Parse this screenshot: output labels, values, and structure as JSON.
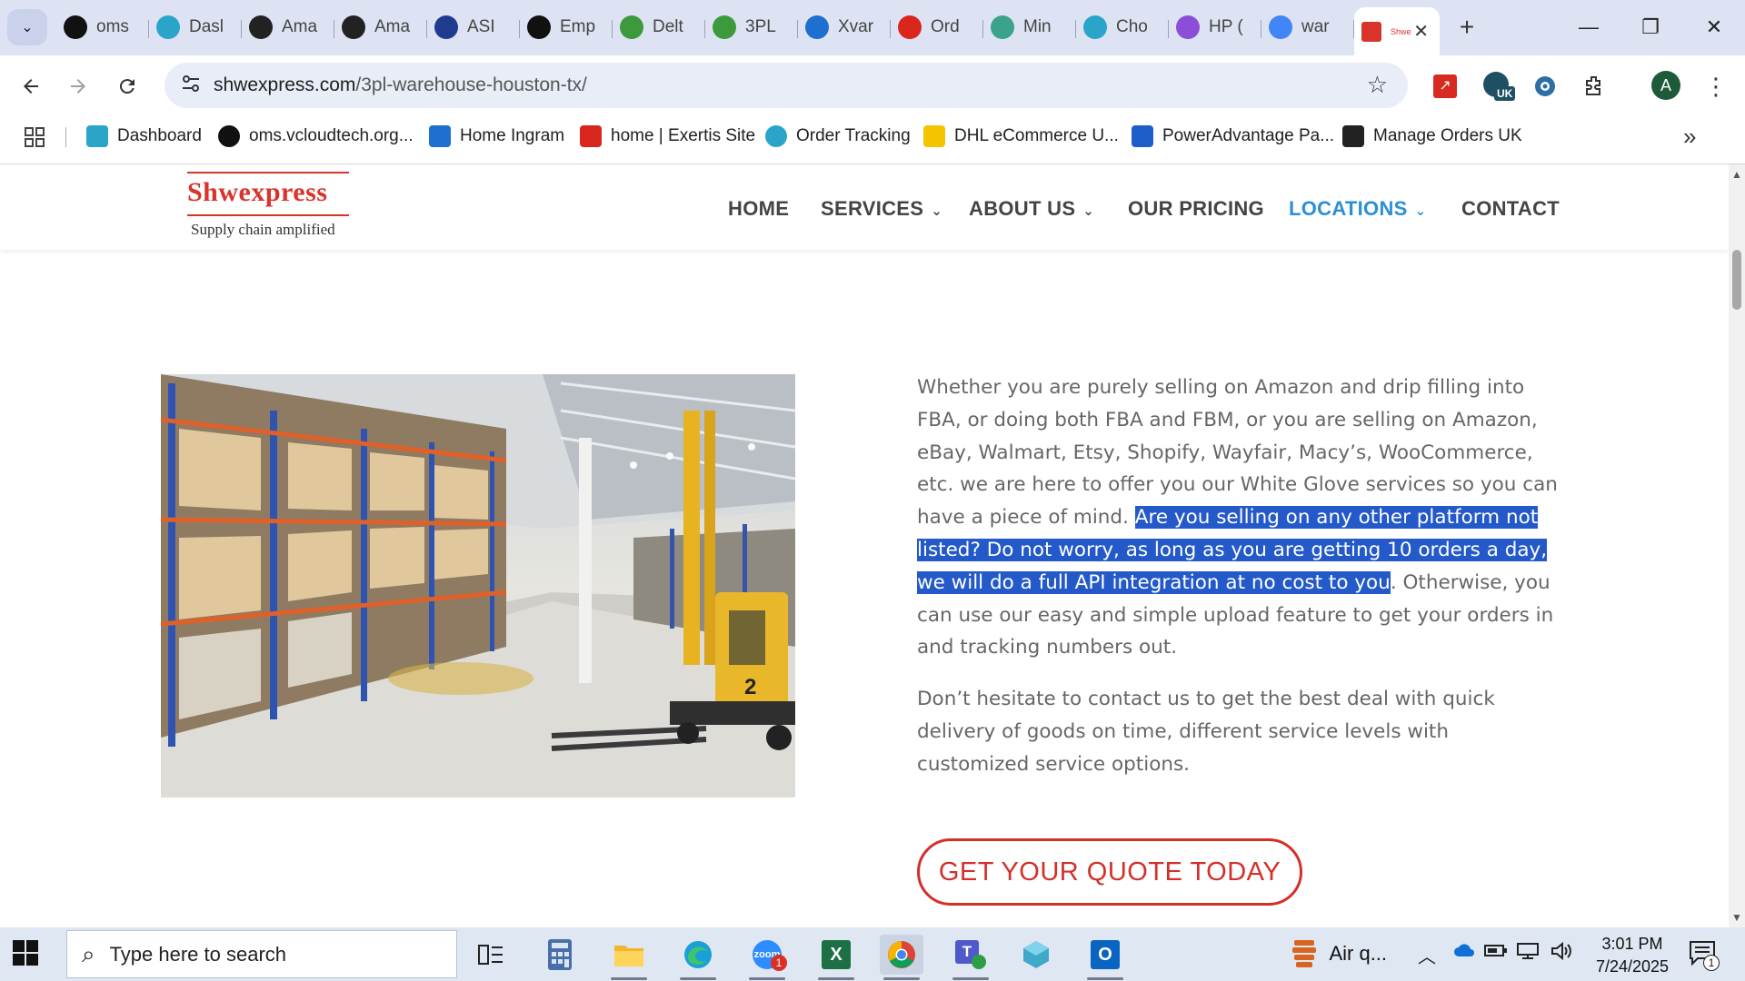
{
  "browser": {
    "tabs": [
      {
        "title": "oms",
        "icon": "vcloud-icon",
        "color": "#111111"
      },
      {
        "title": "Dasl",
        "icon": "dashboard-icon",
        "color": "#2aa5c9"
      },
      {
        "title": "Ama",
        "icon": "amazon-icon",
        "color": "#222222"
      },
      {
        "title": "Ama",
        "icon": "amazon-icon",
        "color": "#222222"
      },
      {
        "title": "ASI",
        "icon": "asi-icon",
        "color": "#1f3b8f"
      },
      {
        "title": "Emp",
        "icon": "openai-icon",
        "color": "#111111"
      },
      {
        "title": "Delt",
        "icon": "spreadsheet-icon",
        "color": "#3c9a3c"
      },
      {
        "title": "3PL",
        "icon": "spreadsheet-icon",
        "color": "#3c9a3c"
      },
      {
        "title": "Xvar",
        "icon": "xvantage-icon",
        "color": "#1e6fcf"
      },
      {
        "title": "Ord",
        "icon": "exertis-icon",
        "color": "#d9261c"
      },
      {
        "title": "Min",
        "icon": "leaf-icon",
        "color": "#3aa38a"
      },
      {
        "title": "Cho",
        "icon": "order-tracking-icon",
        "color": "#2aa5c9"
      },
      {
        "title": "HP (",
        "icon": "hp-icon",
        "color": "#8a4fd6"
      },
      {
        "title": "war",
        "icon": "google-icon",
        "color": "#4285f4"
      },
      {
        "title": "Shwe",
        "icon": "shwexpress-favicon-icon",
        "color": "#d9342b",
        "active": true
      }
    ],
    "close_tab_symbol": "✕",
    "new_tab_symbol": "+",
    "window_controls": {
      "minimize": "—",
      "restore": "❐",
      "close": "✕"
    },
    "url_host": "shwexpress.com",
    "url_path": "/3pl-warehouse-houston-tx/",
    "profile_initial": "A",
    "uk_badge": "UK",
    "bookmarks": [
      {
        "label": "Dashboard",
        "icon": "dashboard-icon",
        "color": "#2aa5c9"
      },
      {
        "label": "oms.vcloudtech.org...",
        "icon": "vcloud-icon",
        "color": "#111111"
      },
      {
        "label": "Home Ingram",
        "icon": "ingram-icon",
        "color": "#1e6fcf"
      },
      {
        "label": "home | Exertis Site",
        "icon": "exertis-icon",
        "color": "#d9261c"
      },
      {
        "label": "Order Tracking",
        "icon": "order-tracking-icon",
        "color": "#2aa5c9"
      },
      {
        "label": "DHL eCommerce U...",
        "icon": "dhl-icon",
        "color": "#f5c400"
      },
      {
        "label": "PowerAdvantage Pa...",
        "icon": "poweradvantage-icon",
        "color": "#1e5ec9"
      },
      {
        "label": "Manage Orders UK",
        "icon": "amazon-icon",
        "color": "#222222"
      }
    ],
    "more_bookmarks": "»"
  },
  "site": {
    "logo_name": "Shwexpress",
    "logo_tagline": "Supply chain amplified",
    "nav": {
      "home": "HOME",
      "services": "SERVICES",
      "about": "ABOUT US",
      "pricing": "OUR PRICING",
      "locations": "LOCATIONS",
      "contact": "CONTACT"
    },
    "paragraph1": {
      "before": "Whether you are purely selling on Amazon and drip filling into FBA, or doing both FBA and FBM, or you are selling on Amazon, eBay, Walmart, Etsy, Shopify, Wayfair, Macy’s, WooCommerce, etc. we are here to offer you our White Glove services so you can have a piece of mind. ",
      "highlighted": "Are you selling on any other platform not listed? Do not worry, as long as you are getting 10 orders a day, we will do a full API integration at no cost to you",
      "after": ". Otherwise, you can use our easy and simple upload feature to get your orders in and tracking numbers out."
    },
    "paragraph2": "Don’t hesitate to contact us to get the best deal with quick delivery of goods on time, different service levels with customized service options.",
    "cta": "GET YOUR QUOTE TODAY",
    "forklift_number": "2",
    "colors": {
      "brand_red": "#d9342b",
      "nav_active": "#2b8fd6",
      "highlight": "#2359c9"
    }
  },
  "taskbar": {
    "search_placeholder": "Type here to search",
    "zoom_badge": "1",
    "weather": "Air q...",
    "time": "3:01 PM",
    "date": "7/24/2025",
    "notification_count": "1"
  }
}
